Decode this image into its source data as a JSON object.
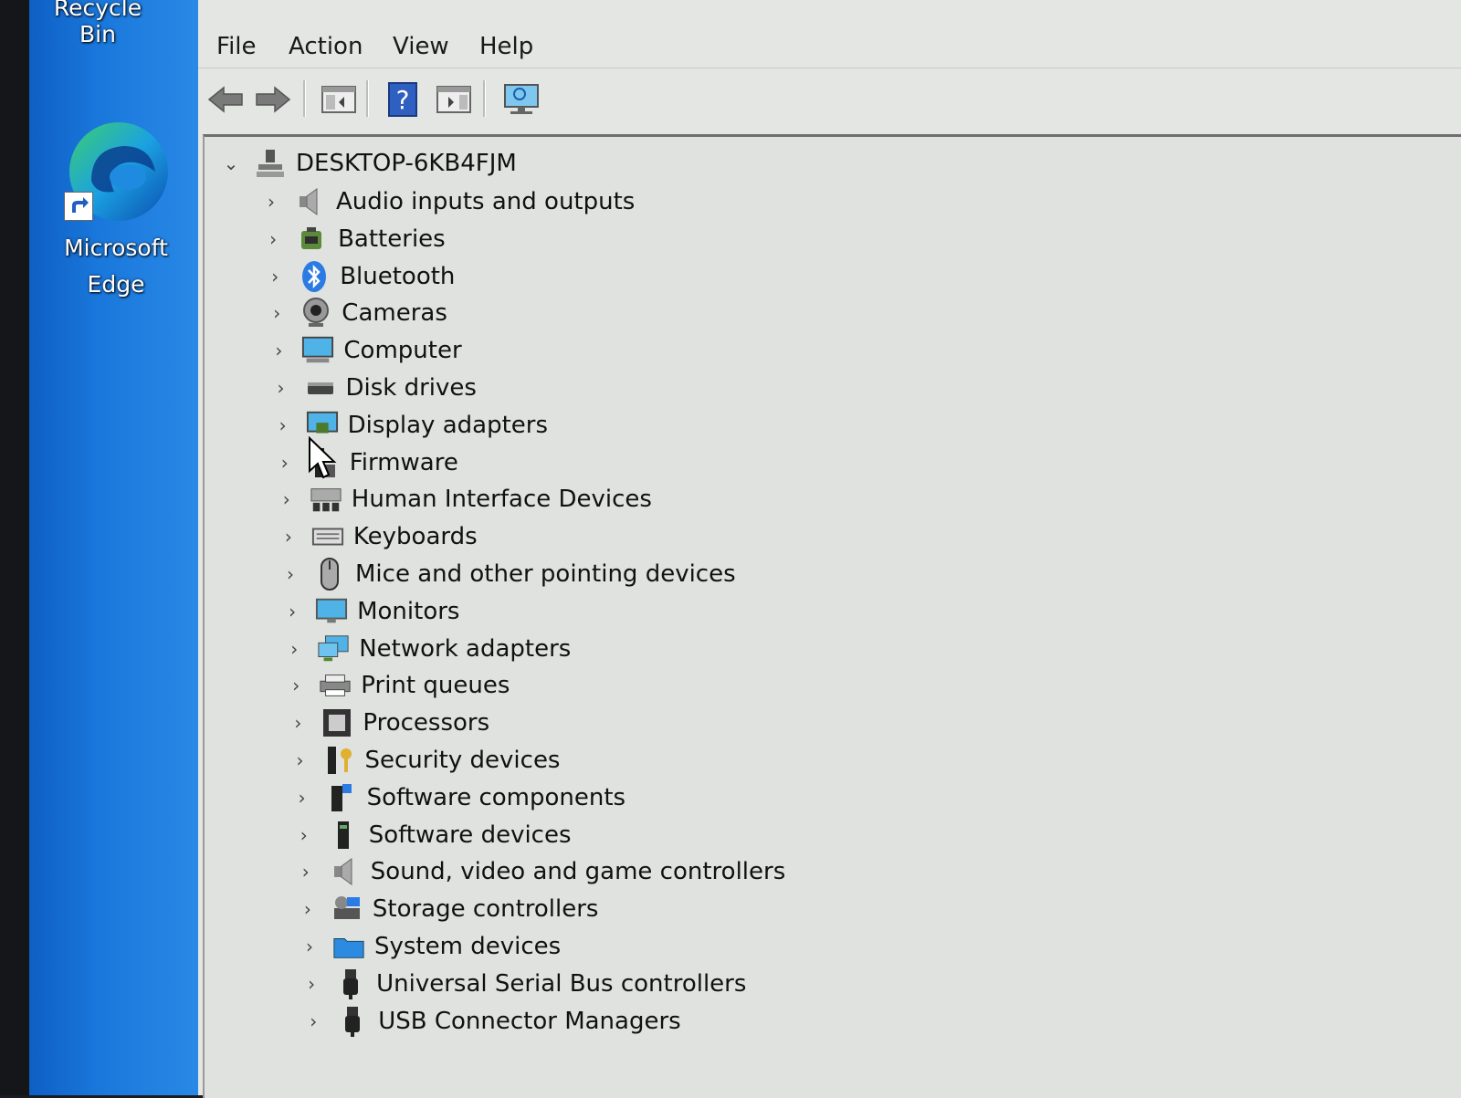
{
  "desktop": {
    "recycle_bin_label": "Recycle Bin",
    "edge_label_line1": "Microsoft",
    "edge_label_line2": "Edge"
  },
  "menu": {
    "file": "File",
    "action": "Action",
    "view": "View",
    "help": "Help"
  },
  "toolbar": {
    "icons": [
      "back-icon",
      "forward-icon",
      "show-hide-console-tree-icon",
      "help-icon",
      "action-pane-icon",
      "monitor-scan-icon"
    ]
  },
  "tree": {
    "root": "DESKTOP-6KB4FJM",
    "items": [
      {
        "label": "Audio inputs and outputs",
        "icon": "speaker-icon"
      },
      {
        "label": "Batteries",
        "icon": "battery-icon"
      },
      {
        "label": "Bluetooth",
        "icon": "bluetooth-icon"
      },
      {
        "label": "Cameras",
        "icon": "camera-icon"
      },
      {
        "label": "Computer",
        "icon": "computer-icon"
      },
      {
        "label": "Disk drives",
        "icon": "disk-drive-icon"
      },
      {
        "label": "Display adapters",
        "icon": "display-adapter-icon"
      },
      {
        "label": "Firmware",
        "icon": "firmware-icon"
      },
      {
        "label": "Human Interface Devices",
        "icon": "hid-icon"
      },
      {
        "label": "Keyboards",
        "icon": "keyboard-icon"
      },
      {
        "label": "Mice and other pointing devices",
        "icon": "mouse-icon"
      },
      {
        "label": "Monitors",
        "icon": "monitor-icon"
      },
      {
        "label": "Network adapters",
        "icon": "network-adapter-icon"
      },
      {
        "label": "Print queues",
        "icon": "printer-icon"
      },
      {
        "label": "Processors",
        "icon": "processor-icon"
      },
      {
        "label": "Security devices",
        "icon": "security-device-icon"
      },
      {
        "label": "Software components",
        "icon": "software-component-icon"
      },
      {
        "label": "Software devices",
        "icon": "software-device-icon"
      },
      {
        "label": "Sound, video and game controllers",
        "icon": "sound-controller-icon"
      },
      {
        "label": "Storage controllers",
        "icon": "storage-controller-icon"
      },
      {
        "label": "System devices",
        "icon": "system-devices-icon"
      },
      {
        "label": "Universal Serial Bus controllers",
        "icon": "usb-icon"
      },
      {
        "label": "USB Connector Managers",
        "icon": "usb-connector-icon"
      }
    ]
  },
  "colors": {
    "desktop_blue": "#1a78dc",
    "pane_bg": "#dfe2df",
    "window_bg": "#e4e6e4"
  }
}
